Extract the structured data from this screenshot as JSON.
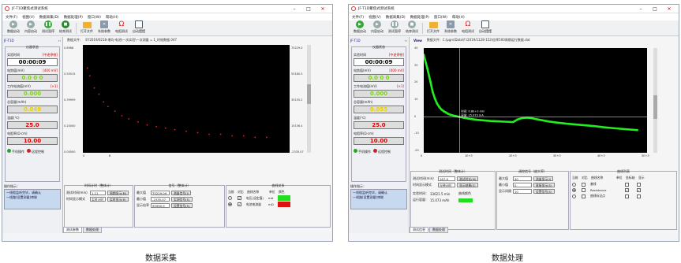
{
  "left_window": {
    "title": "JF-T1D聚焦式测试系统",
    "menu": [
      "文件(F)",
      "视图(V)",
      "数据采集(D)",
      "数据处理(P)",
      "窗口(W)",
      "帮助(H)"
    ],
    "toolbar": [
      "数据启动",
      "内容启动",
      "测试暂停",
      "结束测试",
      "打开文件",
      "系统参数",
      "电阻测试",
      "自动摆摆"
    ],
    "panel_title": "JF-T1D",
    "monitor_group": "仪器状态",
    "fields": [
      {
        "label": "实验时间",
        "tag": "[中途停顿]",
        "value": "00:00:09",
        "style": "white"
      },
      {
        "label": "电势值(mV)",
        "tag": "[400 mV]",
        "value": "0.0 0 0",
        "style": "green"
      },
      {
        "label": "工作电流值(mV)",
        "tag": "[×1]",
        "value": "0.000",
        "style": "green"
      },
      {
        "label": "总容量(mAh)",
        "tag": "",
        "value": "0.049",
        "style": "yellow"
      },
      {
        "label": "温度(℃)",
        "tag": "",
        "value": "25.0",
        "style": "red"
      },
      {
        "label": "电阻率(Ω·cm)",
        "tag": "",
        "value": "10.00",
        "style": "red"
      }
    ],
    "controls": [
      "手机操作",
      "远程控制"
    ],
    "status_label": "操作指示：",
    "status_text": "一线缆监听完毕，请确认\n一线路(设置测量)串联",
    "file_header": "数据文件:",
    "file_path": "EY2019/0218-增均-电池\\一次实验\\一次测量 = 1_时效数据.047",
    "y_left_ticks": [
      "0.6988",
      "0.55515",
      "0.39999",
      "0.20000",
      "0.00000"
    ],
    "y_right_ticks": [
      "75229.0",
      "55180.5",
      "35155.2",
      "15136.4",
      "-2335.07"
    ],
    "x_ticks": [
      "0",
      "8"
    ],
    "chart_data": {
      "type": "scatter",
      "title": "",
      "xlabel": "",
      "ylabel": "",
      "series": [
        {
          "x": [
            0.2,
            0.3,
            0.5,
            0.7,
            0.9,
            1.1,
            1.4,
            1.7,
            2.0,
            2.4,
            2.8,
            3.2,
            3.6,
            4.0,
            4.5,
            5.0,
            5.5,
            6.0,
            6.5,
            7.0,
            7.5,
            8.0
          ],
          "y": [
            0.55,
            0.5,
            0.42,
            0.38,
            0.33,
            0.3,
            0.27,
            0.24,
            0.22,
            0.2,
            0.18,
            0.17,
            0.16,
            0.15,
            0.14,
            0.13,
            0.12,
            0.12,
            0.11,
            0.11,
            0.1,
            0.1
          ]
        }
      ],
      "xlim": [
        0,
        9
      ],
      "ylim": [
        0,
        0.7
      ]
    },
    "time_panel": {
      "title": "时间计时（整体计）",
      "rows": [
        {
          "label": "测试时间(min)",
          "value": "1.11",
          "button": "周期显示(M)"
        },
        {
          "label": "时间显示模式",
          "value": "实时计时",
          "button": "实时显示(R)"
        }
      ]
    },
    "signal_panel": {
      "title": "信号（整体计）",
      "rows": [
        {
          "label": "最大值",
          "value": "75229.09",
          "button": "测量信号(I)"
        },
        {
          "label": "最小值",
          "value": "-2335.07",
          "button": "实测信号(S)"
        },
        {
          "label": "显示倍率",
          "value": "95990.9",
          "button": "设置信号(S)"
        }
      ]
    },
    "curve_panel": {
      "title": "曲线关系",
      "headers": [
        "当前",
        "对比",
        "曲线名称",
        "单位",
        "颜色"
      ],
      "rows": [
        {
          "name": "电压(设定值)",
          "unit": "mA",
          "color": "#22dd22"
        },
        {
          "name": "电池电流量",
          "unit": "mΩ",
          "color": "#dd1111"
        }
      ]
    },
    "tabs": [
      "测试参数",
      "数据处理"
    ],
    "caption": "数据采集"
  },
  "right_window": {
    "title": "JF-T1D聚焦式测试系统",
    "menu": [
      "文件(F)",
      "视图(V)",
      "数据采集(D)",
      "数据处理(P)",
      "窗口(W)",
      "帮助(H)"
    ],
    "toolbar": [
      "数据启动",
      "内容启动",
      "测试暂停",
      "结束测试",
      "打开文件",
      "系统参数",
      "电阻测试",
      "自动摆摆"
    ],
    "panel_title": "JF-T1D",
    "monitor_group": "仪器状态",
    "fields": [
      {
        "label": "实验时间",
        "tag": "[中途停顿]",
        "value": "00:00:09",
        "style": "white"
      },
      {
        "label": "电势值(mV)",
        "tag": "[400 mV]",
        "value": "0.0 0 0",
        "style": "green"
      },
      {
        "label": "工作电流值(mV)",
        "tag": "[×1]",
        "value": "0.000",
        "style": "green"
      },
      {
        "label": "总容量(mAh)",
        "tag": "",
        "value": "0.055",
        "style": "yellow"
      },
      {
        "label": "温度(℃)",
        "tag": "",
        "value": "25.0",
        "style": "red"
      },
      {
        "label": "电阻率(Ω·cm)",
        "tag": "",
        "value": "10.00",
        "style": "red"
      }
    ],
    "controls": [
      "手机操作",
      "远程控制"
    ],
    "status_label": "操作指示：",
    "status_text": "一线缆监听完毕，请确认\n一线路(设置测量)串联",
    "view_label": "View",
    "file_path": "数据文件：C:\\pgrs\\Data\\F:\\2019/1128-152\\倍率500周期运行数据.dat",
    "y_ticks": [
      "40",
      "30",
      "20",
      "10",
      "0",
      "-10",
      "-20"
    ],
    "x_ticks": [
      "0",
      "1E+3",
      "2E+3",
      "3E+3",
      "4E+3",
      "5E+3"
    ],
    "cursor_labels": [
      "时间: 0.8E+3 min",
      "容量: 15.073 mA"
    ],
    "chart_data": {
      "type": "line",
      "title": "",
      "xlabel": "",
      "ylabel": "",
      "series": [
        {
          "x": [
            0,
            80,
            150,
            200,
            250,
            300,
            350,
            400,
            450,
            500,
            550,
            600,
            700,
            800,
            1000,
            1200,
            1500,
            1800,
            2000,
            2100,
            2200,
            2300,
            2400,
            2500,
            2600,
            2800,
            3000,
            3200,
            3500,
            3800,
            4000,
            4200,
            4500,
            4800
          ],
          "y": [
            38,
            30,
            22,
            16,
            12,
            9,
            7,
            5.5,
            4.5,
            3.8,
            3,
            2.5,
            1.8,
            1.2,
            0.2,
            -0.5,
            -1.2,
            -1.6,
            -1.8,
            -0.3,
            0.5,
            0.8,
            0.6,
            0,
            -0.5,
            -1.5,
            -2.2,
            -2.8,
            -3.5,
            -4.2,
            -4.8,
            -5.3,
            -6,
            -6.6
          ]
        }
      ],
      "xlim": [
        0,
        5000
      ],
      "ylim": [
        -20,
        42
      ]
    },
    "time_panel": {
      "title": "测试时间（整体计）",
      "rows": [
        {
          "label": "测试时间(min)",
          "value": "187.9",
          "button": "测试时长(M)"
        },
        {
          "label": "时间显示模式",
          "value": "分钟计时",
          "button": "显示结果(S)"
        }
      ],
      "extra": [
        {
          "label": "实验时间：",
          "value": "33621.5 min"
        },
        {
          "label": "运行容量：",
          "value": "15.073 mAh"
        }
      ],
      "color_label": "曲线颜色"
    },
    "signal_panel": {
      "title": "调控信号（放大率）",
      "rows": [
        {
          "label": "最大值",
          "value": "40",
          "button": "测量显示(I)"
        },
        {
          "label": "最小值",
          "value": "0",
          "button": "直接显示(S)"
        },
        {
          "label": "显示间隔",
          "value": "10",
          "button": "设置信号(S)"
        }
      ]
    },
    "curve_panel": {
      "title": "曲线列表",
      "headers": [
        "当前",
        "对比",
        "曲线名称",
        "单位",
        "坐标轴",
        "显示"
      ],
      "rows": [
        {
          "name": "基线",
          "unit": "",
          "c1": false,
          "c2": false
        },
        {
          "name": "Resistance",
          "unit": "",
          "c1": true,
          "c2": true
        },
        {
          "name": "曲线标记点",
          "unit": "",
          "c1": false,
          "c2": false
        }
      ]
    },
    "tabs": [
      "测试信息",
      "数据处理"
    ],
    "caption": "数据处理"
  }
}
